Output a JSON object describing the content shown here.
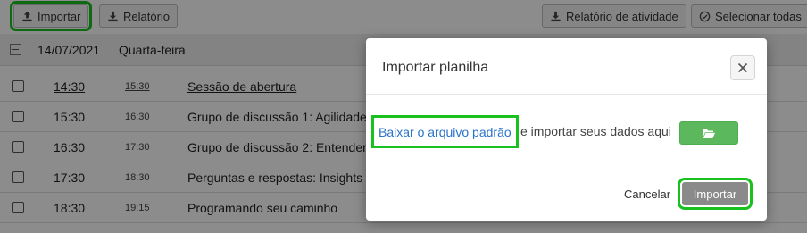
{
  "toolbar": {
    "import_label": "Importar",
    "report_label": "Relatório",
    "activity_report_label": "Relatório de atividade",
    "select_all_label": "Selecionar todas"
  },
  "day": {
    "date": "14/07/2021",
    "weekday": "Quarta-feira"
  },
  "sessions": [
    {
      "start": "14:30",
      "end": "15:30",
      "title": "Sessão de abertura"
    },
    {
      "start": "15:30",
      "end": "16:30",
      "title": "Grupo de discussão 1: Agilidade"
    },
    {
      "start": "16:30",
      "end": "17:30",
      "title": "Grupo de discussão 2: Entender"
    },
    {
      "start": "17:30",
      "end": "18:30",
      "title": "Perguntas e respostas: Insights c"
    },
    {
      "start": "18:30",
      "end": "19:15",
      "title": "Programando seu caminho"
    }
  ],
  "modal": {
    "title": "Importar planilha",
    "download_link": "Baixar o arquivo padrão",
    "download_rest": "e importar seus dados aqui",
    "cancel_label": "Cancelar",
    "import_label": "Importar"
  },
  "colors": {
    "highlight": "#19c11e",
    "link": "#2a73c9",
    "folder_button": "#5cb85c"
  }
}
